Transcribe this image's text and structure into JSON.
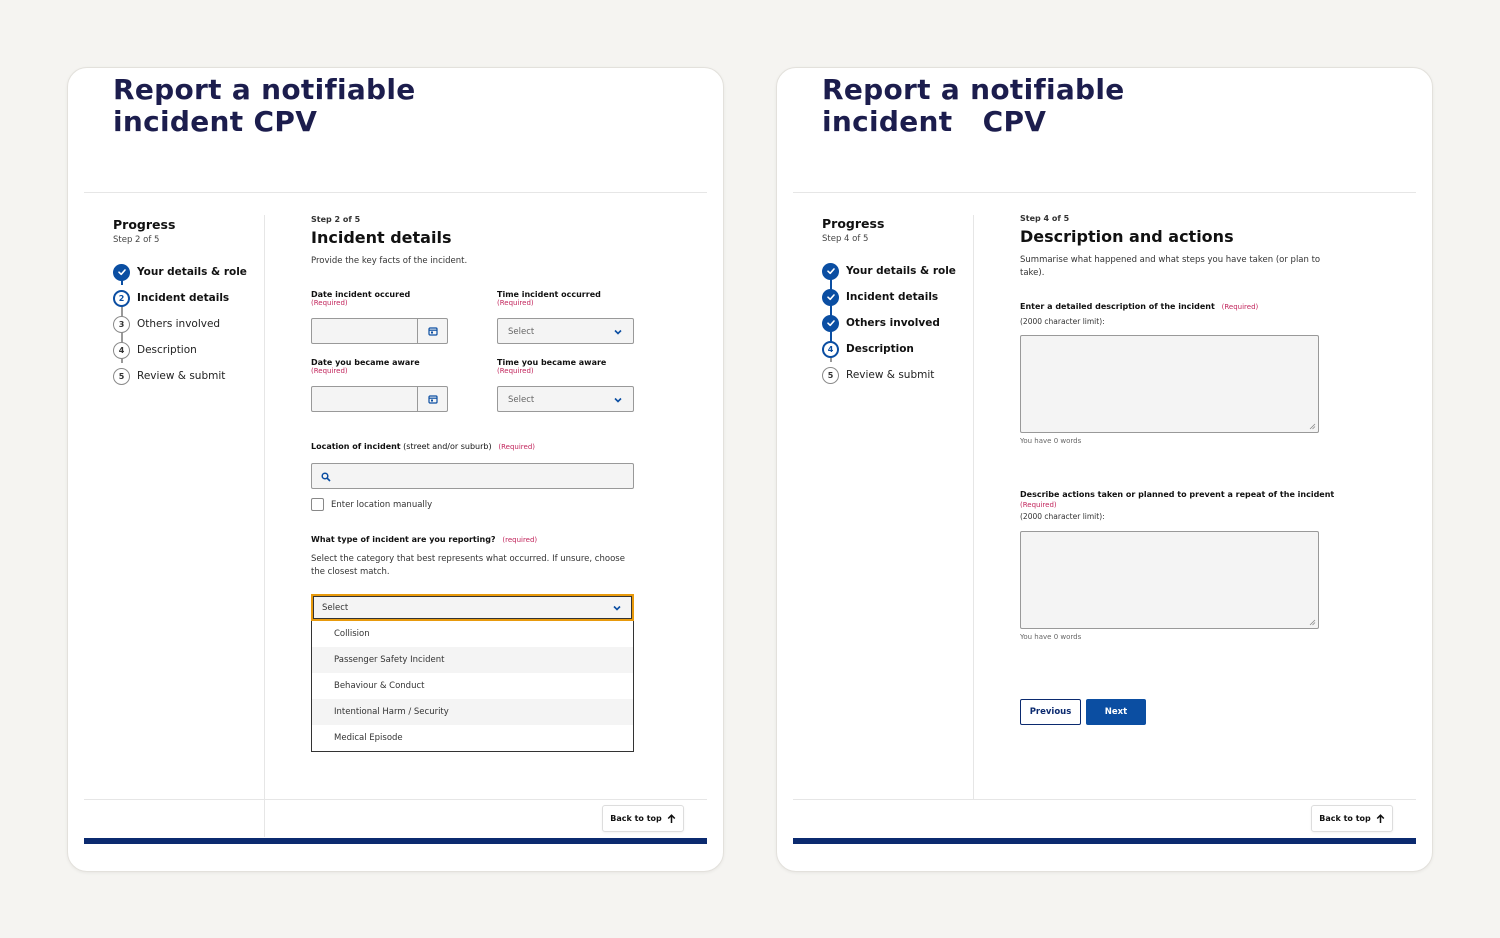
{
  "left": {
    "title_line1": "Report a notifiable",
    "title_line2": "incident CPV",
    "progress": {
      "heading": "Progress",
      "step_text": "Step 2 of 5",
      "steps": [
        {
          "num": "1",
          "label": "Your details & role",
          "state": "done"
        },
        {
          "num": "2",
          "label": "Incident details",
          "state": "current"
        },
        {
          "num": "3",
          "label": "Others involved",
          "state": "todo"
        },
        {
          "num": "4",
          "label": "Description",
          "state": "todo"
        },
        {
          "num": "5",
          "label": "Review & submit",
          "state": "todo"
        }
      ]
    },
    "form": {
      "step_label": "Step 2 of 5",
      "heading": "Incident details",
      "intro": "Provide the key facts of the incident.",
      "date_occurred_label": "Date incident occured",
      "time_occurred_label": "Time incident occurred",
      "date_aware_label": "Date you became aware",
      "time_aware_label": "Time you became aware",
      "required": "(Required)",
      "required_lower": "(required)",
      "time_select_placeholder": "Select",
      "location_label_bold": "Location of incident",
      "location_label_rest": " (street and/or suburb)",
      "manual_label": "Enter location manually",
      "type_question": "What type of incident are you reporting?",
      "type_help": "Select the category that best represents what occurred. If unsure, choose the closest match.",
      "type_select_value": "Select",
      "type_options": [
        "Collision",
        "Passenger Safety Incident",
        "Behaviour & Conduct",
        "Intentional Harm / Security",
        "Medical Episode"
      ]
    },
    "back_to_top": "Back to top"
  },
  "right": {
    "title_line1": "Report a notifiable",
    "title_line2": "incident   CPV",
    "progress": {
      "heading": "Progress",
      "step_text": "Step 4 of 5",
      "steps": [
        {
          "num": "1",
          "label": "Your details & role",
          "state": "done"
        },
        {
          "num": "2",
          "label": "Incident details",
          "state": "done"
        },
        {
          "num": "3",
          "label": "Others involved",
          "state": "done"
        },
        {
          "num": "4",
          "label": "Description",
          "state": "current"
        },
        {
          "num": "5",
          "label": "Review & submit",
          "state": "todo"
        }
      ]
    },
    "form": {
      "step_label": "Step 4 of 5",
      "heading": "Description and actions",
      "intro": "Summarise what happened and what steps you have taken (or plan to take).",
      "desc_label": "Enter a detailed description of the incident",
      "actions_label": "Describe actions taken or planned to prevent a repeat of the incident",
      "required": "(Required)",
      "char_limit": "(2000 character limit):",
      "word_count": "You have 0 words",
      "previous": "Previous",
      "next": "Next"
    },
    "back_to_top": "Back to top"
  },
  "colors": {
    "brand_navy": "#0b2a6f",
    "brand_blue": "#0b4ea2",
    "required": "#c2255c",
    "focus": "#e89a0c",
    "title": "#1c1d4d"
  },
  "icons": {
    "calendar": "calendar-icon",
    "chevron": "chevron-down-icon",
    "search": "search-icon",
    "check": "check-icon",
    "arrow_up": "arrow-up-icon"
  }
}
